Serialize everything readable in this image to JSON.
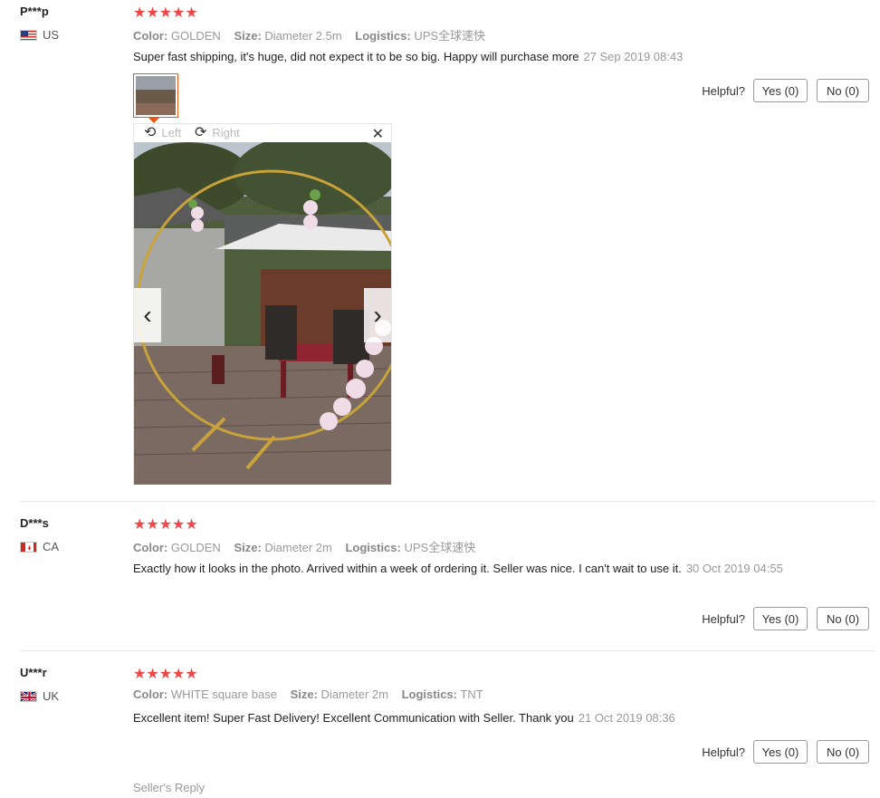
{
  "reviews": [
    {
      "user": "P***p",
      "country": "US",
      "flag_icon": "us-flag-icon",
      "stars": "★★★★★",
      "color_label": "Color:",
      "color": "GOLDEN",
      "size_label": "Size:",
      "size": "Diameter 2.5m",
      "logistics_label": "Logistics:",
      "logistics": "UPS全球速快",
      "text": "Super fast shipping, it's huge, did not expect it to be so big. Happy will purchase more",
      "date": "27 Sep 2019 08:43",
      "helpful": "Helpful?",
      "yes": "Yes (0)",
      "no": "No (0)"
    },
    {
      "user": "D***s",
      "country": "CA",
      "flag_icon": "ca-flag-icon",
      "stars": "★★★★★",
      "color_label": "Color:",
      "color": "GOLDEN",
      "size_label": "Size:",
      "size": "Diameter 2m",
      "logistics_label": "Logistics:",
      "logistics": "UPS全球速快",
      "text": "Exactly how it looks in the photo. Arrived within a week of ordering it. Seller was nice. I can't wait to use it.",
      "date": "30 Oct 2019 04:55",
      "helpful": "Helpful?",
      "yes": "Yes (0)",
      "no": "No (0)"
    },
    {
      "user": "U***r",
      "country": "UK",
      "flag_icon": "uk-flag-icon",
      "stars": "★★★★★",
      "color_label": "Color:",
      "color": "WHITE square base",
      "size_label": "Size:",
      "size": "Diameter 2m",
      "logistics_label": "Logistics:",
      "logistics": "TNT",
      "text": "Excellent item! Super Fast Delivery! Excellent Communication with Seller. Thank you",
      "date": "21 Oct 2019 08:36",
      "helpful": "Helpful?",
      "yes": "Yes (0)",
      "no": "No (0)",
      "seller_reply": "Seller's Reply"
    }
  ],
  "viewer": {
    "rotate_left": "Left",
    "rotate_right": "Right",
    "close": "✕",
    "prev": "‹",
    "next": "›"
  },
  "colors": {
    "star": "#f04848",
    "thumb_border": "#e65a16",
    "muted": "#999999"
  }
}
